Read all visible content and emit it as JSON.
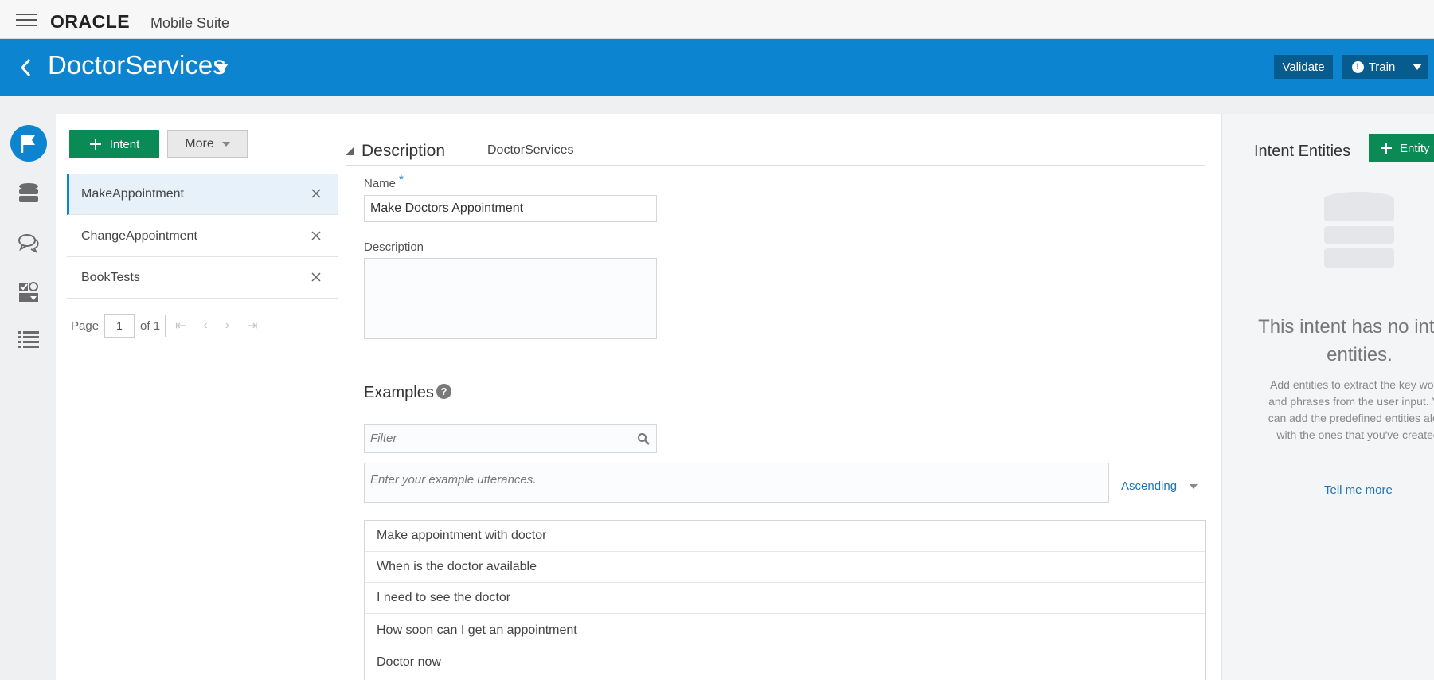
{
  "app": {
    "logo": "ORACLE",
    "suite": "Mobile Suite"
  },
  "header": {
    "bot_name": "DoctorServices",
    "validate_label": "Validate",
    "train_label": "Train"
  },
  "rail": {
    "items": [
      "intents-icon",
      "entities-icon",
      "conversation-icon",
      "components-icon",
      "list-icon"
    ],
    "active": "intents-icon"
  },
  "intent_list": {
    "add_label": "Intent",
    "more_label": "More",
    "items": [
      {
        "label": "MakeAppointment",
        "selected": true
      },
      {
        "label": "ChangeAppointment",
        "selected": false
      },
      {
        "label": "BookTests",
        "selected": false
      }
    ],
    "pager": {
      "page_label": "Page",
      "current": "1",
      "of_label": "of 1"
    }
  },
  "description": {
    "section_title": "Description",
    "intent_name": "DoctorServices",
    "name_label": "Name",
    "required_mark": "*",
    "name_value": "Make Doctors Appointment",
    "description_label": "Description",
    "description_value": ""
  },
  "examples": {
    "title": "Examples",
    "help": "?",
    "filter_placeholder": "Filter",
    "utterance_placeholder": "Enter your example utterances.",
    "sort_label": "Ascending",
    "rows": [
      "Make appointment with doctor",
      "When is the doctor available",
      "I need to see the doctor",
      "How soon can I get an appointment",
      "Doctor now"
    ]
  },
  "entities_panel": {
    "title": "Intent Entities",
    "add_label": "Entity",
    "empty_title": "This intent has no intent entities.",
    "empty_body": "Add entities to extract the key words and phrases from the user input. You can add the predefined entities along with the ones that you've created.",
    "link_label": "Tell me more"
  },
  "colors": {
    "brand_blue": "#0c84d0",
    "dark_blue": "#065b8f",
    "green": "#0a8a54"
  }
}
